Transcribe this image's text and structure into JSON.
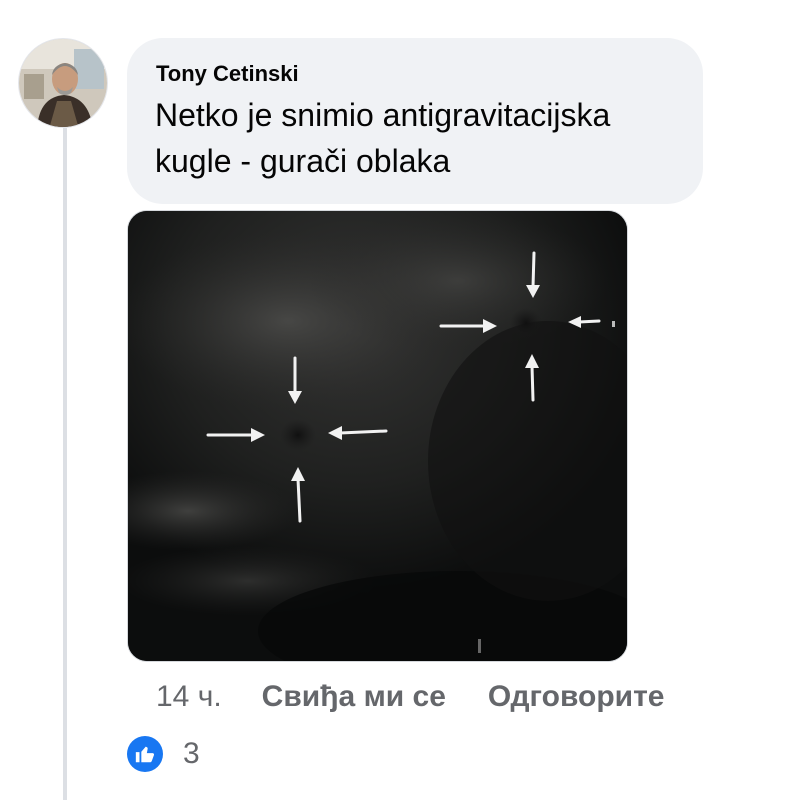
{
  "comment": {
    "author": "Tony Cetinski",
    "text": "Netko je snimio antigravitacijska kugle - gurači oblaka",
    "time": "14 ч.",
    "like_label": "Свиђа ми се",
    "reply_label": "Одговорите",
    "reaction_count": "3"
  },
  "icons": {
    "avatar": "profile-photo",
    "attachment": "night-sky-photo-with-arrows",
    "reaction": "thumbs-up-icon"
  },
  "colors": {
    "bubble": "#f0f2f5",
    "text": "#050505",
    "secondary_text": "#65676b",
    "like_blue": "#1877f2",
    "thread_line": "#dcdfe4"
  }
}
